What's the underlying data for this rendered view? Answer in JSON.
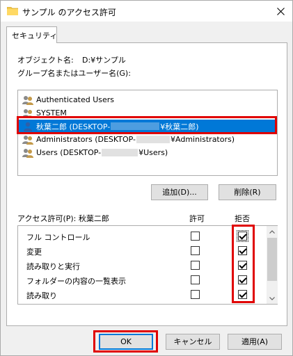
{
  "window": {
    "title": "サンプル のアクセス許可"
  },
  "tabs": [
    {
      "label": "セキュリティ"
    }
  ],
  "object": {
    "label": "オブジェクト名:",
    "value": "D:¥サンプル"
  },
  "group_label": "グループ名またはユーザー名(G):",
  "users": [
    {
      "prefix": "Authenticated Users",
      "suffix": ""
    },
    {
      "prefix": "SYSTEM",
      "suffix": ""
    },
    {
      "prefix": "秋葉二郎 (DESKTOP-",
      "suffix": "¥秋葉二郎)"
    },
    {
      "prefix": "Administrators (DESKTOP-",
      "suffix": "¥Administrators)"
    },
    {
      "prefix": "Users (DESKTOP-",
      "suffix": "¥Users)"
    }
  ],
  "buttons": {
    "add": "追加(D)...",
    "remove": "削除(R)",
    "ok": "OK",
    "cancel": "キャンセル",
    "apply": "適用(A)"
  },
  "permissions": {
    "label": "アクセス許可(P): 秋葉二郎",
    "allow_header": "許可",
    "deny_header": "拒否",
    "rows": [
      {
        "name": "フル コントロール",
        "allow": false,
        "deny": true
      },
      {
        "name": "変更",
        "allow": false,
        "deny": true
      },
      {
        "name": "読み取りと実行",
        "allow": false,
        "deny": true
      },
      {
        "name": "フォルダーの内容の一覧表示",
        "allow": false,
        "deny": true
      },
      {
        "name": "読み取り",
        "allow": false,
        "deny": true
      }
    ]
  },
  "colors": {
    "selection": "#0078d7",
    "highlight_box": "#e00000"
  }
}
